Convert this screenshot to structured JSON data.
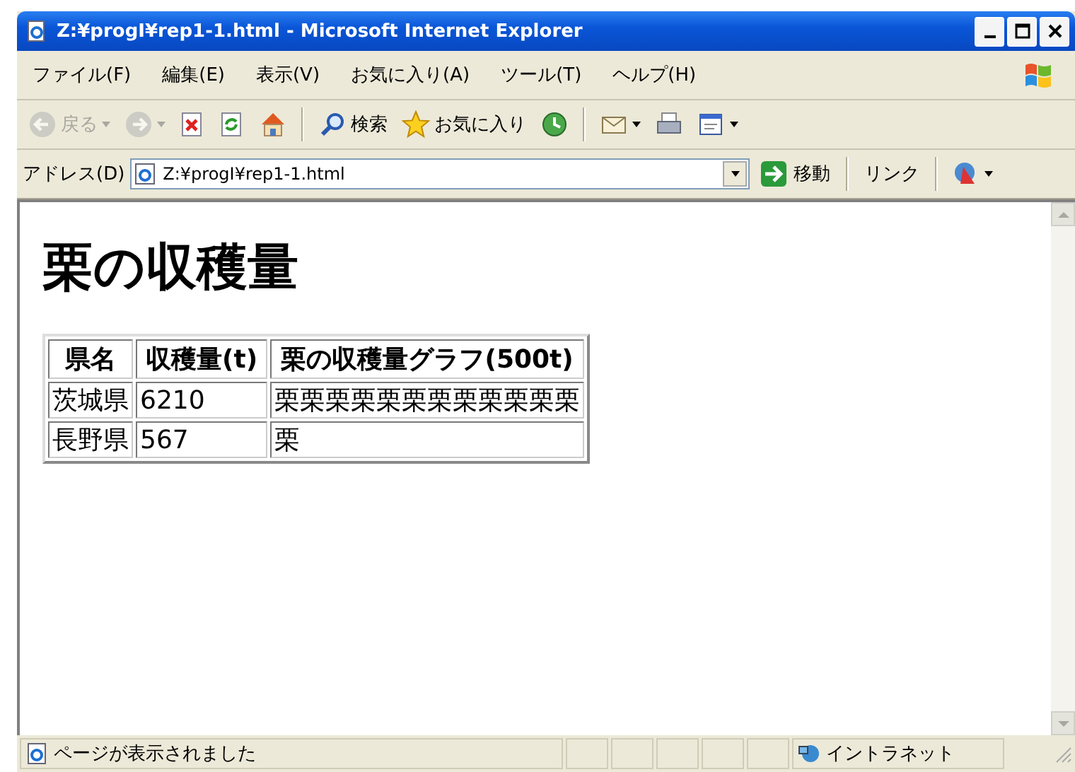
{
  "window": {
    "title": "Z:¥progI¥rep1-1.html - Microsoft Internet Explorer"
  },
  "menu": [
    "ファイル(F)",
    "編集(E)",
    "表示(V)",
    "お気に入り(A)",
    "ツール(T)",
    "ヘルプ(H)"
  ],
  "toolbar": {
    "groups": [
      {
        "buttons": [
          {
            "kind": "back",
            "label": "戻る",
            "disabled": true,
            "dropdown": true
          },
          {
            "kind": "forward",
            "disabled": true,
            "dropdown": true
          },
          {
            "kind": "stop",
            "disabled": false,
            "dropdown": false
          },
          {
            "kind": "refresh",
            "disabled": false,
            "dropdown": false
          },
          {
            "kind": "home",
            "disabled": false,
            "dropdown": false
          }
        ]
      },
      {
        "buttons": [
          {
            "kind": "search",
            "label": "検索",
            "disabled": false,
            "dropdown": false
          },
          {
            "kind": "favorites",
            "label": "お気に入り",
            "disabled": false,
            "dropdown": false
          },
          {
            "kind": "history",
            "disabled": false,
            "dropdown": false
          }
        ]
      },
      {
        "buttons": [
          {
            "kind": "mail",
            "disabled": false,
            "dropdown": true
          },
          {
            "kind": "print",
            "disabled": false,
            "dropdown": false
          },
          {
            "kind": "edit",
            "disabled": false,
            "dropdown": true
          }
        ]
      }
    ]
  },
  "address": {
    "label": "アドレス(D)",
    "value": "Z:¥progI¥rep1-1.html",
    "go": "移動",
    "links": "リンク"
  },
  "page": {
    "heading": "栗の収穫量",
    "table": {
      "columns": [
        "県名",
        "収穫量(t)",
        "栗の収穫量グラフ(500t)"
      ],
      "rows": [
        [
          "茨城県",
          "6210",
          "栗栗栗栗栗栗栗栗栗栗栗栗"
        ],
        [
          "長野県",
          "567",
          "栗"
        ]
      ]
    }
  },
  "status_bar": {
    "message": "ページが表示されました",
    "zone": "イントラネット"
  }
}
